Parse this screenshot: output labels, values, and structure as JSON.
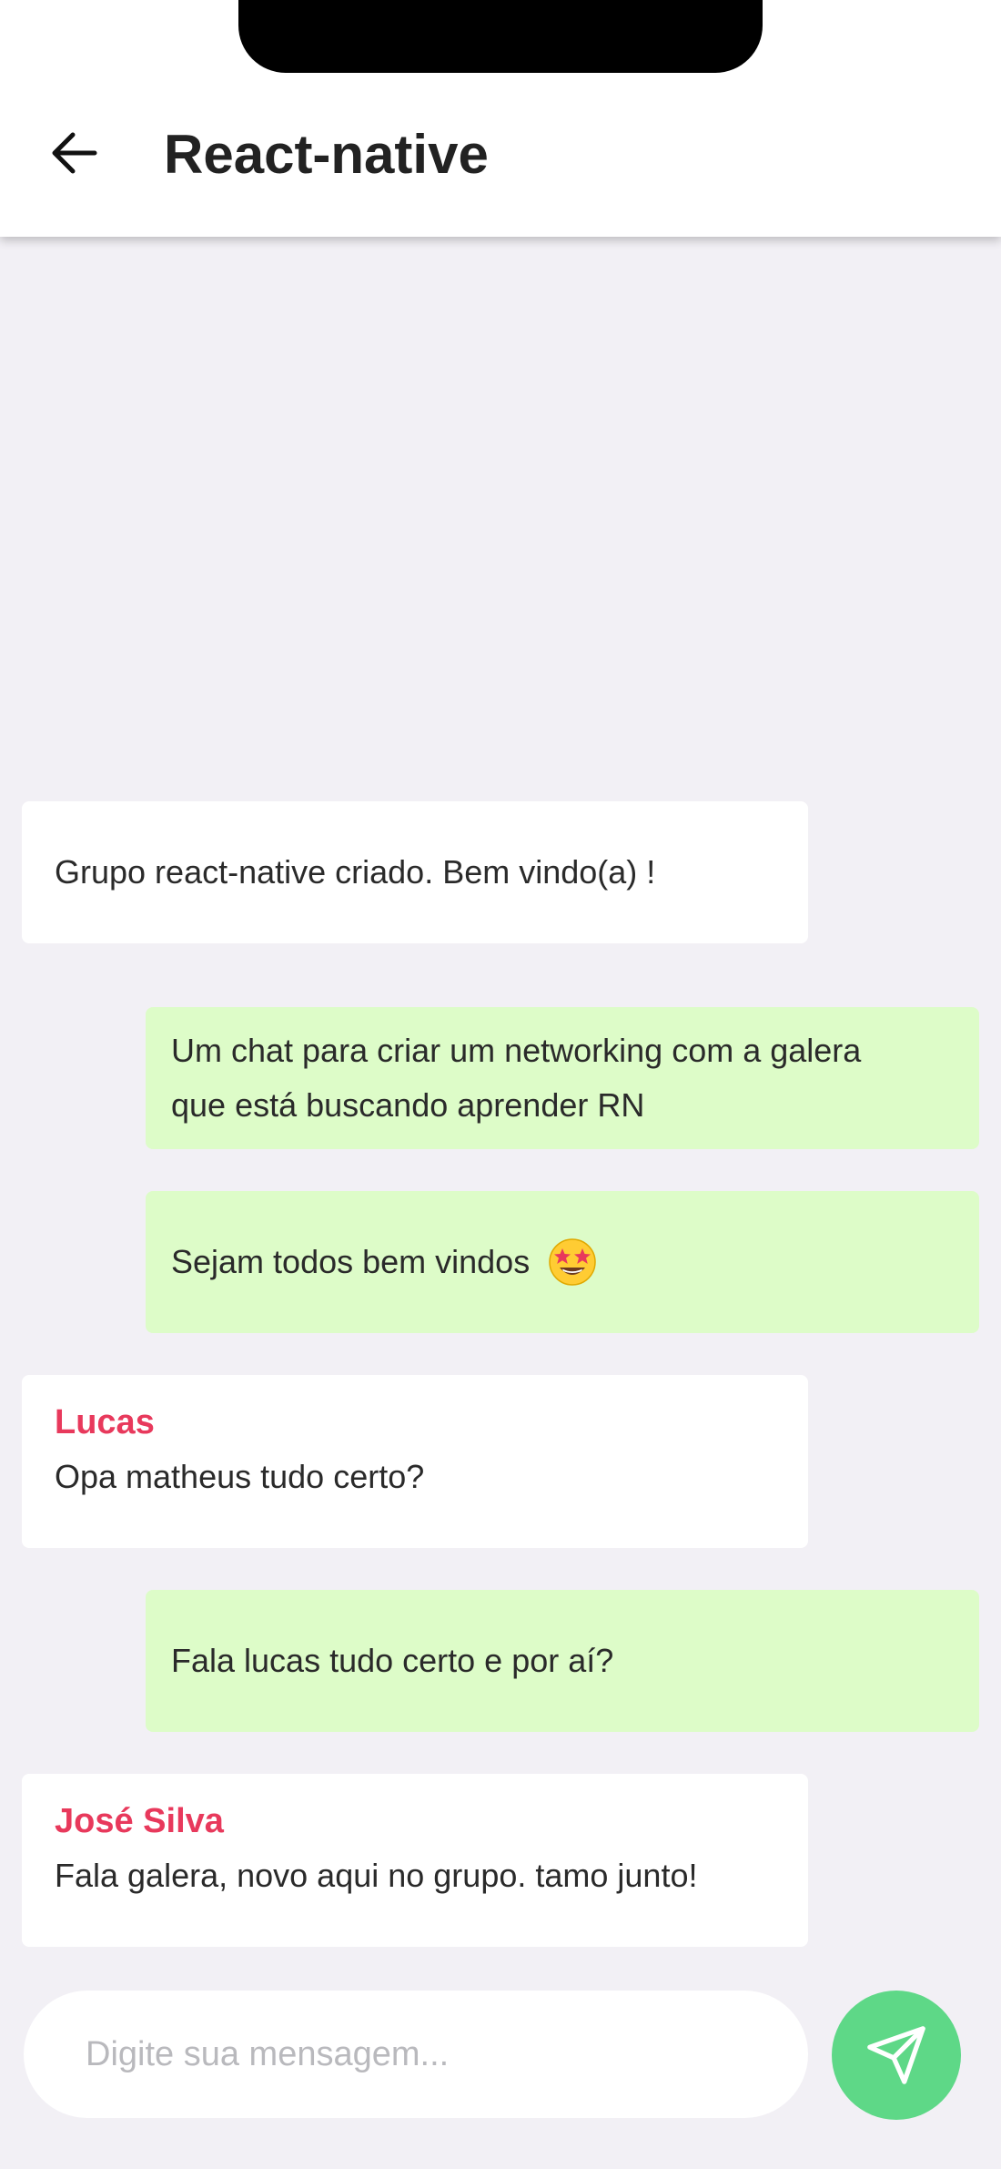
{
  "header": {
    "title": "React-native"
  },
  "messages": [
    {
      "direction": "in",
      "sender": "",
      "text": "Grupo react-native criado. Bem vindo(a) !"
    },
    {
      "direction": "out",
      "text_line1": "Um chat para criar um networking com a galera",
      "text_line2": "que está buscando aprender RN"
    },
    {
      "direction": "out",
      "text": "Sejam todos bem vindos",
      "emoji": "star-struck-emoji"
    },
    {
      "direction": "in",
      "sender": "Lucas",
      "text": "Opa matheus tudo certo?"
    },
    {
      "direction": "out",
      "text": "Fala lucas tudo certo e por aí?"
    },
    {
      "direction": "in",
      "sender": "José Silva",
      "text": "Fala galera, novo aqui no grupo. tamo junto!"
    }
  ],
  "composer": {
    "placeholder": "Digite sua mensagem...",
    "value": ""
  },
  "icons": {
    "back": "arrow-left-icon",
    "send": "send-icon"
  },
  "colors": {
    "incoming_bubble": "#ffffff",
    "outgoing_bubble": "#ddfcc8",
    "sender_name": "#e8395c",
    "send_button": "#5ed887",
    "background": "#f2f0f5"
  }
}
